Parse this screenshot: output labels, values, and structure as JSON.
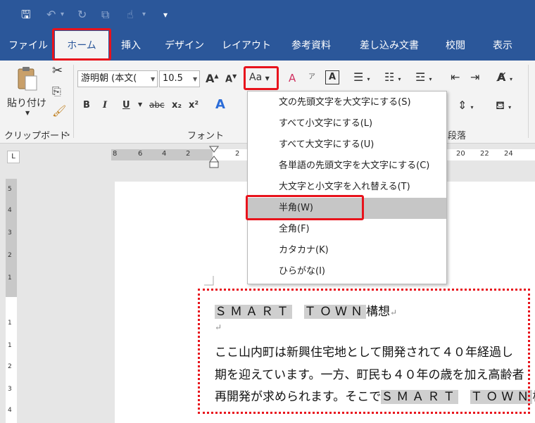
{
  "qat": {
    "save": "🖫",
    "undo": "↶",
    "redo": "↻",
    "format_painter": "⧉",
    "touch": "☝",
    "customize": "▾"
  },
  "tabs": [
    {
      "label": "ファイル"
    },
    {
      "label": "ホーム"
    },
    {
      "label": "挿入"
    },
    {
      "label": "デザイン"
    },
    {
      "label": "レイアウト"
    },
    {
      "label": "参考資料"
    },
    {
      "label": "差し込み文書"
    },
    {
      "label": "校閲"
    },
    {
      "label": "表示"
    }
  ],
  "ribbon": {
    "paste_label": "貼り付け",
    "clipboard_label": "クリップボード",
    "font_group_label": "フォント",
    "paragraph_group_label": "段落",
    "font_name": "游明朝 (本文(",
    "font_size": "10.5",
    "grow_font": "A",
    "shrink_font": "A",
    "change_case": "Aa",
    "clear_format": "A",
    "phonetic": "ア",
    "char_border": "A",
    "bold": "B",
    "italic": "I",
    "underline": "U",
    "strike": "abc",
    "subscript": "x₂",
    "superscript": "x²",
    "text_effect": "A"
  },
  "ruler": {
    "tab_selector": "L",
    "numbers": [
      "8",
      "6",
      "4",
      "2",
      "2",
      "20",
      "22",
      "24"
    ],
    "vnumbers": [
      "5",
      "4",
      "3",
      "2",
      "1",
      "1",
      "1",
      "2",
      "3",
      "4"
    ]
  },
  "change_case_menu": [
    {
      "label": "文の先頭文字を大文字にする(S)"
    },
    {
      "label": "すべて小文字にする(L)"
    },
    {
      "label": "すべて大文字にする(U)"
    },
    {
      "label": "各単語の先頭文字を大文字にする(C)"
    },
    {
      "label": "大文字と小文字を入れ替える(T)"
    },
    {
      "label": "半角(W)"
    },
    {
      "label": "全角(F)"
    },
    {
      "label": "カタカナ(K)"
    },
    {
      "label": "ひらがな(I)"
    }
  ],
  "document": {
    "title_word1": "ＳＭＡＲＴ",
    "title_word2": "ＴＯＷＮ",
    "title_suffix": "構想",
    "para_mark": "↵",
    "line1": "ここ山内町は新興住宅地として開発されて４０年経過し",
    "line2": "期を迎えています。一方、町民も４０年の歳を加え高齢者",
    "line3_prefix": "再開発が求められます。そこで",
    "line3_word1": "ＳＭＡＲＴ",
    "line3_word2": "ＴＯＷＮ",
    "line3_suffix": "構想"
  }
}
